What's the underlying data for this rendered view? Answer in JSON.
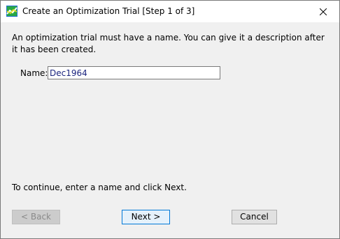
{
  "window": {
    "title": "Create an Optimization Trial [Step 1 of 3]",
    "app_icon": "chart-app-icon",
    "close_icon": "close-icon"
  },
  "content": {
    "instructions": "An optimization trial must have a name. You can give it a description after it has been created.",
    "name_label": "Name:",
    "name_value": "Dec1964",
    "continue_hint": "To continue, enter a name and click Next."
  },
  "buttons": {
    "back_label": "< Back",
    "back_enabled": false,
    "next_label": "Next >",
    "cancel_label": "Cancel"
  },
  "colors": {
    "input_text": "#1a237e",
    "default_button_border": "#0078d7"
  }
}
